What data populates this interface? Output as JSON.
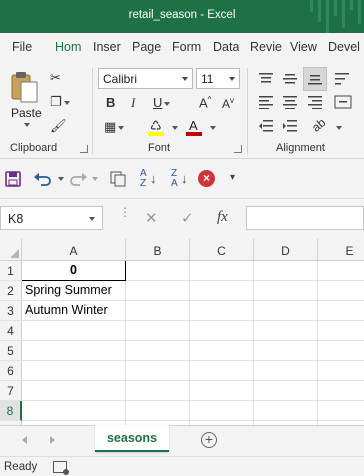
{
  "window": {
    "title": "retail_season  -  Excel"
  },
  "ribbon_tabs": [
    {
      "label": "File"
    },
    {
      "label": "Hom"
    },
    {
      "label": "Inser"
    },
    {
      "label": "Page"
    },
    {
      "label": "Form"
    },
    {
      "label": "Data"
    },
    {
      "label": "Revie"
    },
    {
      "label": "View"
    },
    {
      "label": "Devel"
    }
  ],
  "active_tab_index": 1,
  "clipboard": {
    "paste_label": "Paste",
    "group_label": "Clipboard"
  },
  "font": {
    "name": "Calibri",
    "size": "11",
    "group_label": "Font"
  },
  "alignment": {
    "group_label": "Alignment"
  },
  "formula_bar": {
    "name_box": "K8",
    "fx_label": "fx",
    "value": ""
  },
  "columns": [
    "A",
    "B",
    "C",
    "D",
    "E"
  ],
  "rows": [
    "1",
    "2",
    "3",
    "4",
    "5",
    "6",
    "7",
    "8"
  ],
  "cells": {
    "A1": "0",
    "A2": "Spring Summer",
    "A3": "Autumn Winter"
  },
  "selected_row": "8",
  "sheets": [
    {
      "name": "seasons",
      "active": true
    }
  ],
  "status": {
    "text": "Ready"
  },
  "colors": {
    "accent": "#1e7145",
    "font_color_bar": "#c00000",
    "highlight_bar": "#ffff00",
    "error_icon": "#d13438"
  }
}
